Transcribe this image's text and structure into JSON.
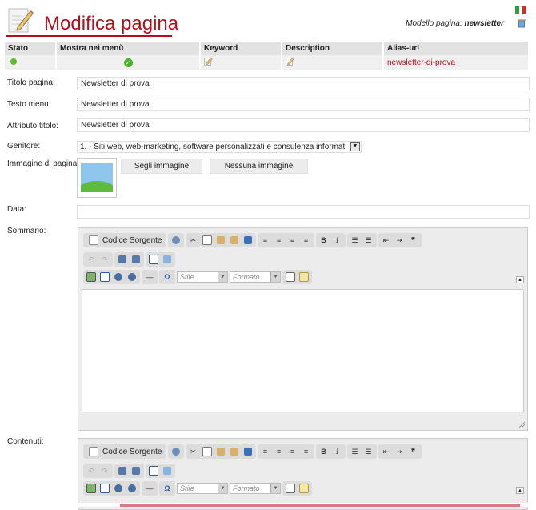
{
  "header": {
    "title": "Modifica pagina",
    "model_label": "Modello pagina:",
    "model_value": "newsletter"
  },
  "status_table": {
    "headers": [
      "Stato",
      "Mostra nei menù",
      "Keyword",
      "Description",
      "Alias-url"
    ],
    "alias": "newsletter-di-prova"
  },
  "form": {
    "titolo_label": "Titolo pagina:",
    "titolo_value": "Newsletter di prova",
    "testo_label": "Testo menu:",
    "testo_value": "Newsletter di prova",
    "attributo_label": "Attributo titolo:",
    "attributo_value": "Newsletter di prova",
    "genitore_label": "Genitore:",
    "genitore_value": "1. - Siti web, web-marketing, software personalizzati e consulenza informat",
    "immagine_label": "Immagine di pagina:",
    "scegli_label": "Segli immagine",
    "nessuna_label": "Nessuna immagine",
    "data_label": "Data:",
    "data_value": "",
    "sommario_label": "Sommario:",
    "contenuti_label": "Contenuti:"
  },
  "editor": {
    "source_label": "Codice Sorgente",
    "stile_label": "Stile",
    "formato_label": "Formato"
  },
  "colors": {
    "brand": "#b0121b",
    "status_green": "#5fbf2a"
  }
}
